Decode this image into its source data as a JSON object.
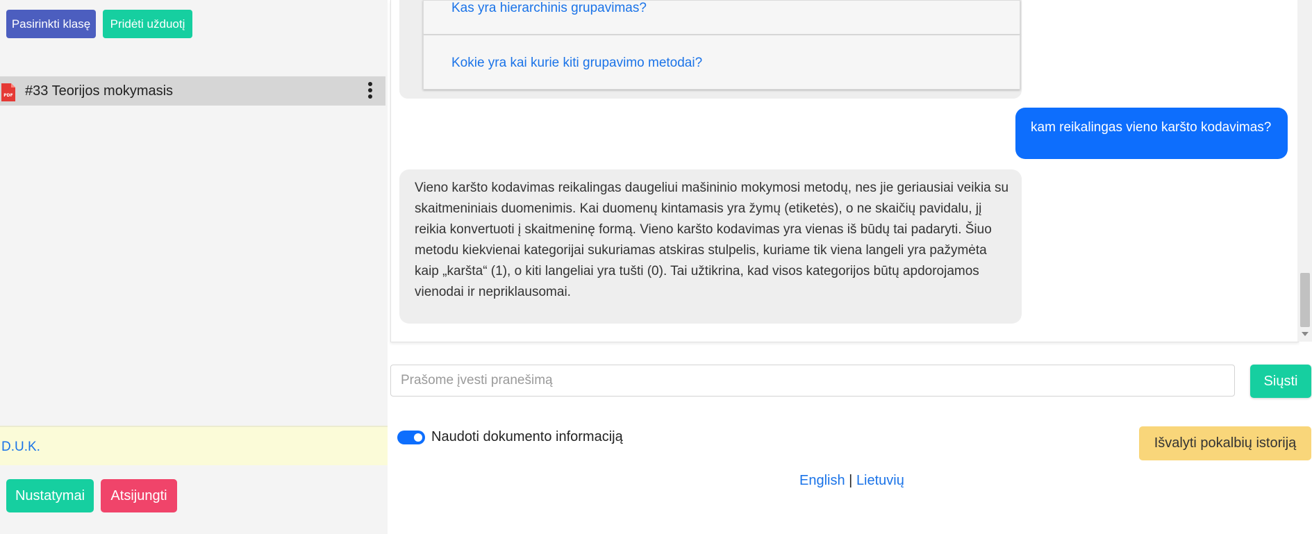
{
  "sidebar": {
    "select_class_label": "Pasirinkti klasę",
    "add_task_label": "Pridėti užduotį",
    "documents": [
      {
        "title": "#33 Teorijos mokymasis",
        "icon": "pdf-file-icon"
      }
    ],
    "faq_label": "D.U.K.",
    "settings_label": "Nustatymai",
    "logout_label": "Atsijungti"
  },
  "chat": {
    "suggestions": [
      "Kas yra hierarchinis grupavimas?",
      "Kokie yra kai kurie kiti grupavimo metodai?"
    ],
    "user_message": "kam reikalingas vieno karšto kodavimas?",
    "bot_message": "Vieno karšto kodavimas reikalingas daugeliui mašininio mokymosi metodų, nes jie geriausiai veikia su skaitmeniniais duomenimis. Kai duomenų kintamasis yra žymų (etiketės), o ne skaičių pavidalu, jį reikia konvertuoti į skaitmeninę formą. Vieno karšto kodavimas yra vienas iš būdų tai padaryti. Šiuo metodu kiekvienai kategorijai sukuriamas atskiras stulpelis, kuriame tik viena langeli yra pažymėta kaip „karšta“ (1), o kiti langeliai yra tušti (0). Tai užtikrina, kad visos kategorijos būtų apdorojamos vienodai ir nepriklausomai."
  },
  "input": {
    "placeholder": "Prašome įvesti pranešimą",
    "send_label": "Siųsti"
  },
  "options": {
    "use_document_label": "Naudoti dokumento informaciją",
    "use_document_enabled": true,
    "clear_history_label": "Išvalyti pokalbių istoriją"
  },
  "footer": {
    "lang_en": "English",
    "separator": "|",
    "lang_lt": "Lietuvių"
  },
  "colors": {
    "primary": "#0d6efd",
    "success": "#16cfa0",
    "danger": "#f0446a",
    "warning": "#f9d67a",
    "indigo": "#4c5ebf"
  }
}
